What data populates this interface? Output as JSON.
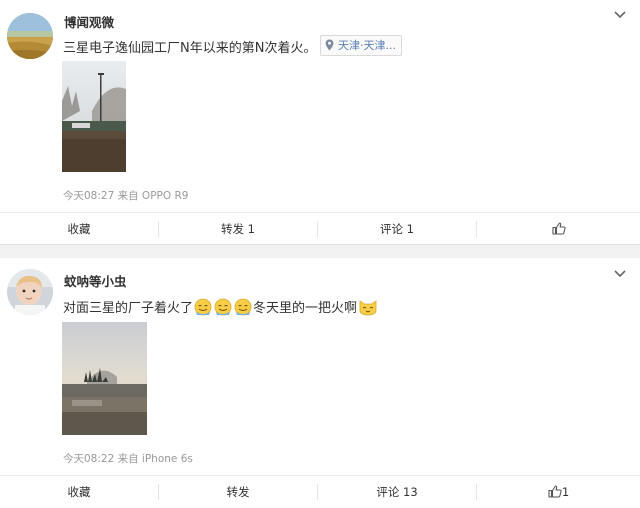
{
  "posts": [
    {
      "author": "博闻观微",
      "text": "三星电子逸仙园工厂N年以来的第N次着火。",
      "location": "天津·天津...",
      "meta": "今天08:27 来自 OPPO R9",
      "actions": {
        "favorite": "收藏",
        "repost": "转发 1",
        "comment": "评论 1",
        "like": ""
      }
    },
    {
      "author": "蚊呐等小虫",
      "text_before": "对面三星的厂子着火了",
      "text_after": "冬天里的一把火啊",
      "meta": "今天08:22 来自 iPhone 6s",
      "actions": {
        "favorite": "收藏",
        "repost": "转发",
        "comment": "评论 13",
        "like": "1"
      }
    }
  ],
  "icons": [
    "chevron-down-icon",
    "location-pin-icon",
    "thumbs-up-icon",
    "sweat-smile-emoji",
    "cat-emoji"
  ]
}
